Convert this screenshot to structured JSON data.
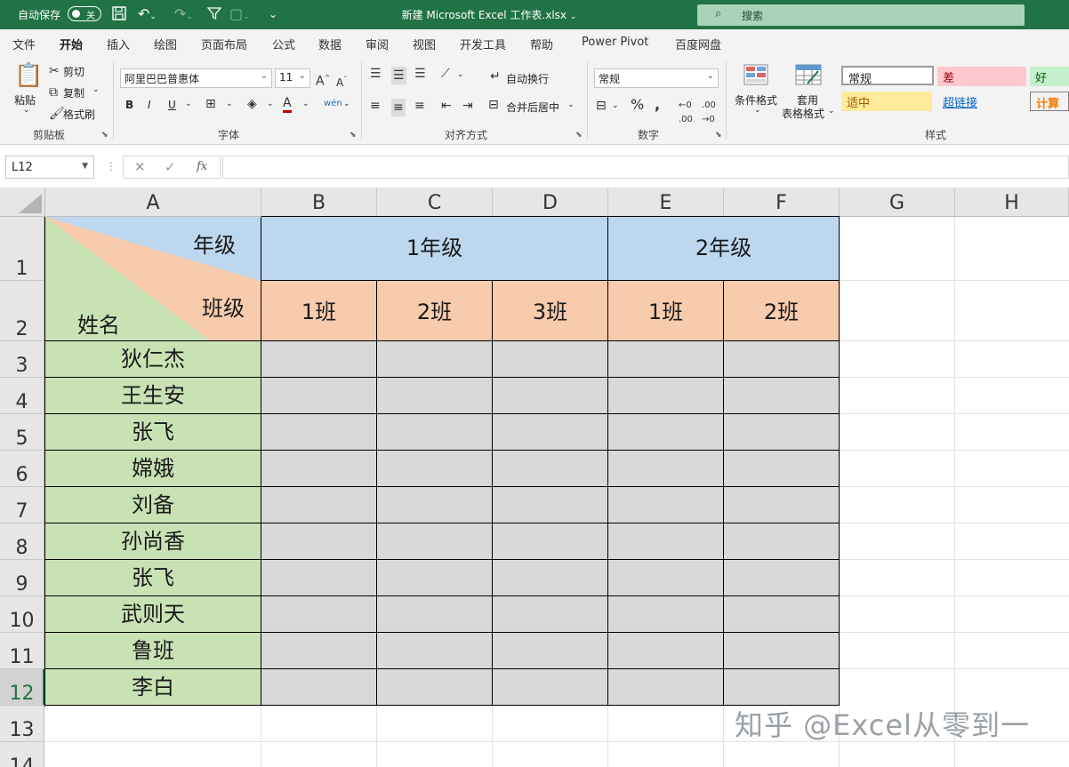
{
  "titlebar": {
    "autosave_label": "自动保存",
    "autosave_state": "关",
    "document_title": "新建 Microsoft Excel 工作表.xlsx",
    "search_placeholder": "搜索"
  },
  "ribbon_tabs": [
    "文件",
    "开始",
    "插入",
    "绘图",
    "页面布局",
    "公式",
    "数据",
    "审阅",
    "视图",
    "开发工具",
    "帮助",
    "Power Pivot",
    "百度网盘"
  ],
  "ribbon": {
    "clipboard": {
      "paste": "粘贴",
      "cut": "剪切",
      "copy": "复制",
      "format_painter": "格式刷",
      "label": "剪贴板"
    },
    "font": {
      "family": "阿里巴巴普惠体",
      "size": "11",
      "bold": "B",
      "italic": "I",
      "underline": "U",
      "label": "字体"
    },
    "alignment": {
      "wrap_text": "自动换行",
      "merge_center": "合并后居中",
      "label": "对齐方式"
    },
    "number": {
      "format": "常规",
      "label": "数字"
    },
    "styles": {
      "conditional_format": "条件格式",
      "table_format_1": "套用",
      "table_format_2": "表格格式",
      "cells": [
        "常规",
        "差",
        "好",
        "适中",
        "超链接",
        "计算"
      ],
      "label": "样式"
    }
  },
  "formula_bar": {
    "name_box": "L12",
    "formula": ""
  },
  "columns": [
    "A",
    "B",
    "C",
    "D",
    "E",
    "F",
    "G",
    "H"
  ],
  "rows": [
    "1",
    "2",
    "3",
    "4",
    "5",
    "6",
    "7",
    "8",
    "9",
    "10",
    "11",
    "12",
    "13",
    "14"
  ],
  "active_row": "12",
  "table": {
    "corner_top": "年级",
    "corner_middle": "班级",
    "corner_bottom": "姓名",
    "grades": [
      "1年级",
      "2年级"
    ],
    "classes": [
      "1班",
      "2班",
      "3班",
      "1班",
      "2班"
    ],
    "names": [
      "狄仁杰",
      "王生安",
      "张飞",
      "嫦娥",
      "刘备",
      "孙尚香",
      "张飞",
      "武则天",
      "鲁班",
      "李白"
    ]
  },
  "watermark": "知乎 @Excel从零到一",
  "colors": {
    "excel_green": "#217346",
    "grade_blue": "#bdd7ee",
    "class_orange": "#f8cbad",
    "name_green": "#c9e2b4",
    "blank_gray": "#d9d9d9"
  }
}
